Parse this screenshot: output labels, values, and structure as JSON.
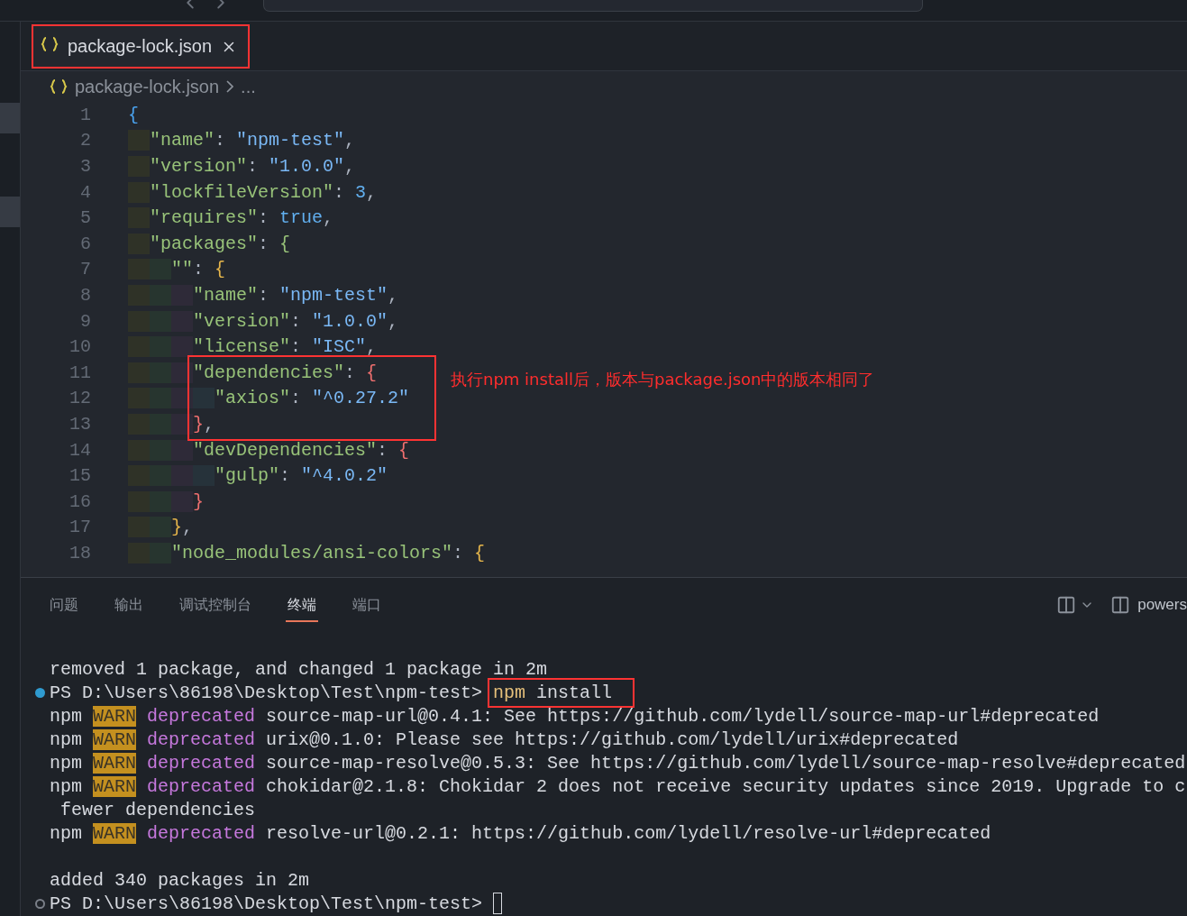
{
  "editor_tab": {
    "label": "package-lock.json",
    "selected": true,
    "annotated": true
  },
  "breadcrumbs": {
    "file": "package-lock.json",
    "more": "..."
  },
  "code_lines": [
    {
      "number": "1",
      "tokens": [
        {
          "kind": "brace1",
          "text": "{"
        }
      ]
    },
    {
      "number": "2",
      "tokens": [
        {
          "kind": "key",
          "text": "  \"name\""
        },
        {
          "kind": "punct",
          "text": ": "
        },
        {
          "kind": "string",
          "text": "\"npm-test\""
        },
        {
          "kind": "punct",
          "text": ","
        }
      ]
    },
    {
      "number": "3",
      "tokens": [
        {
          "kind": "key",
          "text": "  \"version\""
        },
        {
          "kind": "punct",
          "text": ": "
        },
        {
          "kind": "string",
          "text": "\"1.0.0\""
        },
        {
          "kind": "punct",
          "text": ","
        }
      ]
    },
    {
      "number": "4",
      "tokens": [
        {
          "kind": "key",
          "text": "  \"lockfileVersion\""
        },
        {
          "kind": "punct",
          "text": ": "
        },
        {
          "kind": "number",
          "text": "3"
        },
        {
          "kind": "punct",
          "text": ","
        }
      ]
    },
    {
      "number": "5",
      "tokens": [
        {
          "kind": "key",
          "text": "  \"requires\""
        },
        {
          "kind": "punct",
          "text": ": "
        },
        {
          "kind": "number",
          "text": "true"
        },
        {
          "kind": "punct",
          "text": ","
        }
      ]
    },
    {
      "number": "6",
      "tokens": [
        {
          "kind": "key",
          "text": "  \"packages\""
        },
        {
          "kind": "punct",
          "text": ": "
        },
        {
          "kind": "brace2",
          "text": "{"
        }
      ]
    },
    {
      "number": "7",
      "tokens": [
        {
          "kind": "key",
          "text": "    \"\""
        },
        {
          "kind": "punct",
          "text": ": "
        },
        {
          "kind": "brace3",
          "text": "{"
        }
      ]
    },
    {
      "number": "8",
      "tokens": [
        {
          "kind": "key",
          "text": "      \"name\""
        },
        {
          "kind": "punct",
          "text": ": "
        },
        {
          "kind": "string",
          "text": "\"npm-test\""
        },
        {
          "kind": "punct",
          "text": ","
        }
      ]
    },
    {
      "number": "9",
      "tokens": [
        {
          "kind": "key",
          "text": "      \"version\""
        },
        {
          "kind": "punct",
          "text": ": "
        },
        {
          "kind": "string",
          "text": "\"1.0.0\""
        },
        {
          "kind": "punct",
          "text": ","
        }
      ]
    },
    {
      "number": "10",
      "tokens": [
        {
          "kind": "key",
          "text": "      \"license\""
        },
        {
          "kind": "punct",
          "text": ": "
        },
        {
          "kind": "string",
          "text": "\"ISC\""
        },
        {
          "kind": "punct",
          "text": ","
        }
      ]
    },
    {
      "number": "11",
      "boxed": true,
      "note": "执行npm install后，版本与package.json中的版本相同了",
      "tokens": [
        {
          "kind": "key",
          "text": "      \"dependencies\""
        },
        {
          "kind": "punct",
          "text": ": "
        },
        {
          "kind": "brace4",
          "text": "{"
        }
      ]
    },
    {
      "number": "12",
      "boxed": true,
      "tokens": [
        {
          "kind": "key",
          "text": "        \"axios\""
        },
        {
          "kind": "punct",
          "text": ": "
        },
        {
          "kind": "string",
          "text": "\"^0.27.2\""
        }
      ]
    },
    {
      "number": "13",
      "boxed": true,
      "tokens": [
        {
          "kind": "brace4",
          "text": "      }"
        },
        {
          "kind": "punct",
          "text": ","
        }
      ]
    },
    {
      "number": "14",
      "tokens": [
        {
          "kind": "key",
          "text": "      \"devDependencies\""
        },
        {
          "kind": "punct",
          "text": ": "
        },
        {
          "kind": "brace4",
          "text": "{"
        }
      ]
    },
    {
      "number": "15",
      "tokens": [
        {
          "kind": "key",
          "text": "        \"gulp\""
        },
        {
          "kind": "punct",
          "text": ": "
        },
        {
          "kind": "string",
          "text": "\"^4.0.2\""
        }
      ]
    },
    {
      "number": "16",
      "tokens": [
        {
          "kind": "brace4",
          "text": "      }"
        }
      ]
    },
    {
      "number": "17",
      "tokens": [
        {
          "kind": "brace3",
          "text": "    }"
        },
        {
          "kind": "punct",
          "text": ","
        }
      ]
    },
    {
      "number": "18",
      "tokens": [
        {
          "kind": "key",
          "text": "    \"node_modules/ansi-colors\""
        },
        {
          "kind": "punct",
          "text": ": "
        },
        {
          "kind": "brace3",
          "text": "{"
        }
      ]
    }
  ],
  "panel_tabs": [
    {
      "label": "问题",
      "selected": false
    },
    {
      "label": "输出",
      "selected": false
    },
    {
      "label": "调试控制台",
      "selected": false
    },
    {
      "label": "终端",
      "selected": true
    },
    {
      "label": "端口",
      "selected": false
    }
  ],
  "terminal_label": "powers",
  "terminal_lines": [
    {
      "kind": "output",
      "segments": [
        {
          "kind": "plain",
          "text": "removed 1 package, and changed 1 package in 2m"
        }
      ]
    },
    {
      "kind": "prompt",
      "succeeded": true,
      "segments": [
        {
          "kind": "plain",
          "text": "PS D:\\Users\\86198\\Desktop\\Test\\npm-test>"
        },
        {
          "kind": "command",
          "text": "npm",
          "annotated": true
        },
        {
          "kind": "plain",
          "text": "install",
          "annotated": true
        }
      ]
    },
    {
      "kind": "output",
      "segments": [
        {
          "kind": "plain",
          "text": "npm"
        },
        {
          "kind": "warn",
          "text": "WARN"
        },
        {
          "kind": "deprecated",
          "text": "deprecated"
        },
        {
          "kind": "plain",
          "text": "source-map-url@0.4.1: See https://github.com/lydell/source-map-url#deprecated"
        }
      ]
    },
    {
      "kind": "output",
      "segments": [
        {
          "kind": "plain",
          "text": "npm"
        },
        {
          "kind": "warn",
          "text": "WARN"
        },
        {
          "kind": "deprecated",
          "text": "deprecated"
        },
        {
          "kind": "plain",
          "text": "urix@0.1.0: Please see https://github.com/lydell/urix#deprecated"
        }
      ]
    },
    {
      "kind": "output",
      "segments": [
        {
          "kind": "plain",
          "text": "npm"
        },
        {
          "kind": "warn",
          "text": "WARN"
        },
        {
          "kind": "deprecated",
          "text": "deprecated"
        },
        {
          "kind": "plain",
          "text": "source-map-resolve@0.5.3: See https://github.com/lydell/source-map-resolve#deprecated"
        }
      ]
    },
    {
      "kind": "output",
      "segments": [
        {
          "kind": "plain",
          "text": "npm"
        },
        {
          "kind": "warn",
          "text": "WARN"
        },
        {
          "kind": "deprecated",
          "text": "deprecated"
        },
        {
          "kind": "plain",
          "text": "chokidar@2.1.8: Chokidar 2 does not receive security updates since 2019. Upgrade to c"
        }
      ]
    },
    {
      "kind": "output",
      "segments": [
        {
          "kind": "plain",
          "text": " fewer dependencies"
        }
      ]
    },
    {
      "kind": "output",
      "segments": [
        {
          "kind": "plain",
          "text": "npm"
        },
        {
          "kind": "warn",
          "text": "WARN"
        },
        {
          "kind": "deprecated",
          "text": "deprecated"
        },
        {
          "kind": "plain",
          "text": "resolve-url@0.2.1: https://github.com/lydell/resolve-url#deprecated"
        }
      ]
    },
    {
      "kind": "blank"
    },
    {
      "kind": "output",
      "segments": [
        {
          "kind": "plain",
          "text": "added 340 packages in 2m"
        }
      ]
    },
    {
      "kind": "prompt",
      "succeeded": false,
      "cursor": true,
      "segments": [
        {
          "kind": "plain",
          "text": "PS D:\\Users\\86198\\Desktop\\Test\\npm-test>"
        }
      ]
    }
  ]
}
